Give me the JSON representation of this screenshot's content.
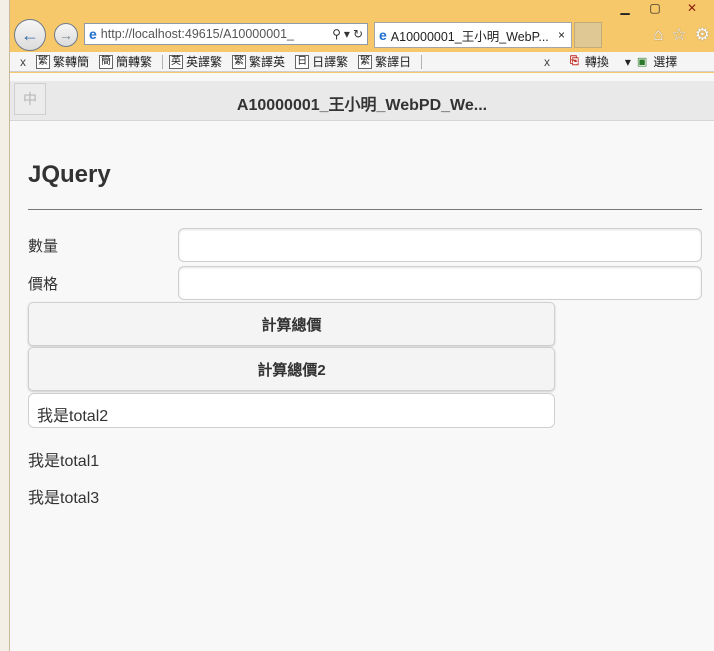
{
  "browser": {
    "address": "http://localhost:49615/A10000001_",
    "tab_title": "A10000001_王小明_WebP...",
    "tab_close": "×"
  },
  "command_bar": {
    "close_label": "x",
    "items": [
      {
        "icon": "繁",
        "label": "繁轉簡"
      },
      {
        "icon": "簡",
        "label": "簡轉繁"
      },
      {
        "icon": "英",
        "label": "英譯繁"
      },
      {
        "icon": "繁",
        "label": "繁譯英"
      },
      {
        "icon": "日",
        "label": "日譯繁"
      },
      {
        "icon": "繁",
        "label": "繁譯日"
      }
    ],
    "close_label_2": "x",
    "convert_label": "轉換",
    "select_label": "選擇"
  },
  "header": {
    "button_label": "中",
    "title": "A10000001_王小明_WebPD_We..."
  },
  "main": {
    "heading": "JQuery",
    "quantity_label": "數量",
    "quantity_value": "",
    "price_label": "價格",
    "price_value": "",
    "calc_button": "計算總價",
    "calc_button_2": "計算總價2",
    "total2_value": "我是total2",
    "total1_text": "我是total1",
    "total3_text": "我是total3"
  },
  "icons": {
    "back": "back-arrow-icon",
    "forward": "forward-arrow-icon",
    "ie": "ie-icon",
    "search": "search-icon",
    "refresh": "refresh-icon",
    "home": "home-icon",
    "favorites": "star-icon",
    "settings": "gear-icon"
  }
}
